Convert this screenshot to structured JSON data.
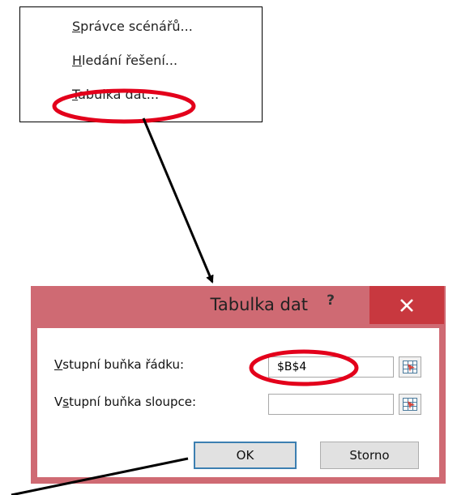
{
  "menu": {
    "items": [
      {
        "accel": "S",
        "rest": "právce scénářů..."
      },
      {
        "accel": "H",
        "rest": "ledání řešení..."
      },
      {
        "accel": "T",
        "rest": "abulka dat..."
      }
    ]
  },
  "dialog": {
    "title": "Tabulka dat",
    "help_label": "?",
    "row_input": {
      "label_pre": "",
      "label_accel": "V",
      "label_post": "stupní buňka řádku:",
      "value": "$B$4"
    },
    "column_input": {
      "label_pre": "V",
      "label_accel": "s",
      "label_post": "tupní buňka sloupce:",
      "value": ""
    },
    "ok_label": "OK",
    "cancel_label": "Storno"
  },
  "colors": {
    "dialog_frame": "#cf6a73",
    "close_button": "#c8383f",
    "annotation": "#e3001b",
    "arrow": "#000000"
  },
  "icons": [
    "close-icon",
    "collapse-dialog-icon"
  ]
}
